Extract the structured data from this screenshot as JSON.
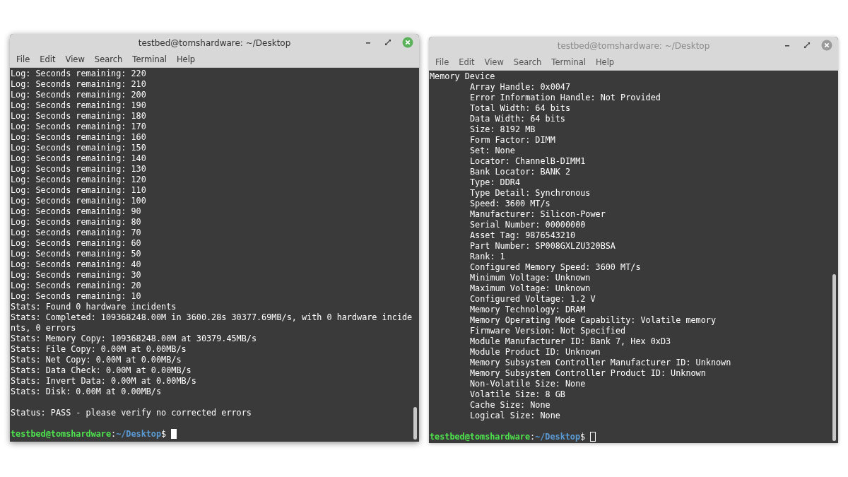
{
  "windows": [
    {
      "active": true,
      "title": "testbed@tomshardware: ~/Desktop",
      "menu": [
        "File",
        "Edit",
        "View",
        "Search",
        "Terminal",
        "Help"
      ],
      "lines": [
        {
          "kind": "text",
          "text": "Log: Seconds remaining: 220"
        },
        {
          "kind": "text",
          "text": "Log: Seconds remaining: 210"
        },
        {
          "kind": "text",
          "text": "Log: Seconds remaining: 200"
        },
        {
          "kind": "text",
          "text": "Log: Seconds remaining: 190"
        },
        {
          "kind": "text",
          "text": "Log: Seconds remaining: 180"
        },
        {
          "kind": "text",
          "text": "Log: Seconds remaining: 170"
        },
        {
          "kind": "text",
          "text": "Log: Seconds remaining: 160"
        },
        {
          "kind": "text",
          "text": "Log: Seconds remaining: 150"
        },
        {
          "kind": "text",
          "text": "Log: Seconds remaining: 140"
        },
        {
          "kind": "text",
          "text": "Log: Seconds remaining: 130"
        },
        {
          "kind": "text",
          "text": "Log: Seconds remaining: 120"
        },
        {
          "kind": "text",
          "text": "Log: Seconds remaining: 110"
        },
        {
          "kind": "text",
          "text": "Log: Seconds remaining: 100"
        },
        {
          "kind": "text",
          "text": "Log: Seconds remaining: 90"
        },
        {
          "kind": "text",
          "text": "Log: Seconds remaining: 80"
        },
        {
          "kind": "text",
          "text": "Log: Seconds remaining: 70"
        },
        {
          "kind": "text",
          "text": "Log: Seconds remaining: 60"
        },
        {
          "kind": "text",
          "text": "Log: Seconds remaining: 50"
        },
        {
          "kind": "text",
          "text": "Log: Seconds remaining: 40"
        },
        {
          "kind": "text",
          "text": "Log: Seconds remaining: 30"
        },
        {
          "kind": "text",
          "text": "Log: Seconds remaining: 20"
        },
        {
          "kind": "text",
          "text": "Log: Seconds remaining: 10"
        },
        {
          "kind": "text",
          "text": "Stats: Found 0 hardware incidents"
        },
        {
          "kind": "text",
          "text": "Stats: Completed: 109368248.00M in 3600.28s 30377.69MB/s, with 0 hardware incide"
        },
        {
          "kind": "text",
          "text": "nts, 0 errors"
        },
        {
          "kind": "text",
          "text": "Stats: Memory Copy: 109368248.00M at 30379.45MB/s"
        },
        {
          "kind": "text",
          "text": "Stats: File Copy: 0.00M at 0.00MB/s"
        },
        {
          "kind": "text",
          "text": "Stats: Net Copy: 0.00M at 0.00MB/s"
        },
        {
          "kind": "text",
          "text": "Stats: Data Check: 0.00M at 0.00MB/s"
        },
        {
          "kind": "text",
          "text": "Stats: Invert Data: 0.00M at 0.00MB/s"
        },
        {
          "kind": "text",
          "text": "Stats: Disk: 0.00M at 0.00MB/s"
        },
        {
          "kind": "blank"
        },
        {
          "kind": "text",
          "text": "Status: PASS - please verify no corrected errors"
        }
      ],
      "prompt": {
        "user_host": "testbed@tomshardware",
        "separator": ":",
        "path": "~/Desktop",
        "symbol": "$"
      }
    },
    {
      "active": false,
      "title": "testbed@tomshardware: ~/Desktop",
      "menu": [
        "File",
        "Edit",
        "View",
        "Search",
        "Terminal",
        "Help"
      ],
      "lines": [
        {
          "kind": "text",
          "text": "Memory Device",
          "children": [
            {
              "text": "Array Handle: 0x0047"
            },
            {
              "text": "Error Information Handle: Not Provided"
            },
            {
              "text": "Total Width: 64 bits"
            },
            {
              "text": "Data Width: 64 bits"
            },
            {
              "text": "Size: 8192 MB"
            },
            {
              "text": "Form Factor: DIMM"
            },
            {
              "text": "Set: None"
            },
            {
              "text": "Locator: ChannelB-DIMM1"
            },
            {
              "text": "Bank Locator: BANK 2"
            },
            {
              "text": "Type: DDR4"
            },
            {
              "text": "Type Detail: Synchronous"
            },
            {
              "text": "Speed: 3600 MT/s"
            },
            {
              "text": "Manufacturer: Silicon-Power"
            },
            {
              "text": "Serial Number: 00000000"
            },
            {
              "text": "Asset Tag: 9876543210"
            },
            {
              "text": "Part Number: SP008GXLZU320BSA"
            },
            {
              "text": "Rank: 1"
            },
            {
              "text": "Configured Memory Speed: 3600 MT/s"
            },
            {
              "text": "Minimum Voltage: Unknown"
            },
            {
              "text": "Maximum Voltage: Unknown"
            },
            {
              "text": "Configured Voltage: 1.2 V"
            },
            {
              "text": "Memory Technology: DRAM"
            },
            {
              "text": "Memory Operating Mode Capability: Volatile memory"
            },
            {
              "text": "Firmware Version: Not Specified"
            },
            {
              "text": "Module Manufacturer ID: Bank 7, Hex 0xD3"
            },
            {
              "text": "Module Product ID: Unknown"
            },
            {
              "text": "Memory Subsystem Controller Manufacturer ID: Unknown"
            },
            {
              "text": "Memory Subsystem Controller Product ID: Unknown"
            },
            {
              "text": "Non-Volatile Size: None"
            },
            {
              "text": "Volatile Size: 8 GB"
            },
            {
              "text": "Cache Size: None"
            },
            {
              "text": "Logical Size: None"
            }
          ]
        }
      ],
      "prompt": {
        "user_host": "testbed@tomshardware",
        "separator": ":",
        "path": "~/Desktop",
        "symbol": "$"
      }
    }
  ]
}
